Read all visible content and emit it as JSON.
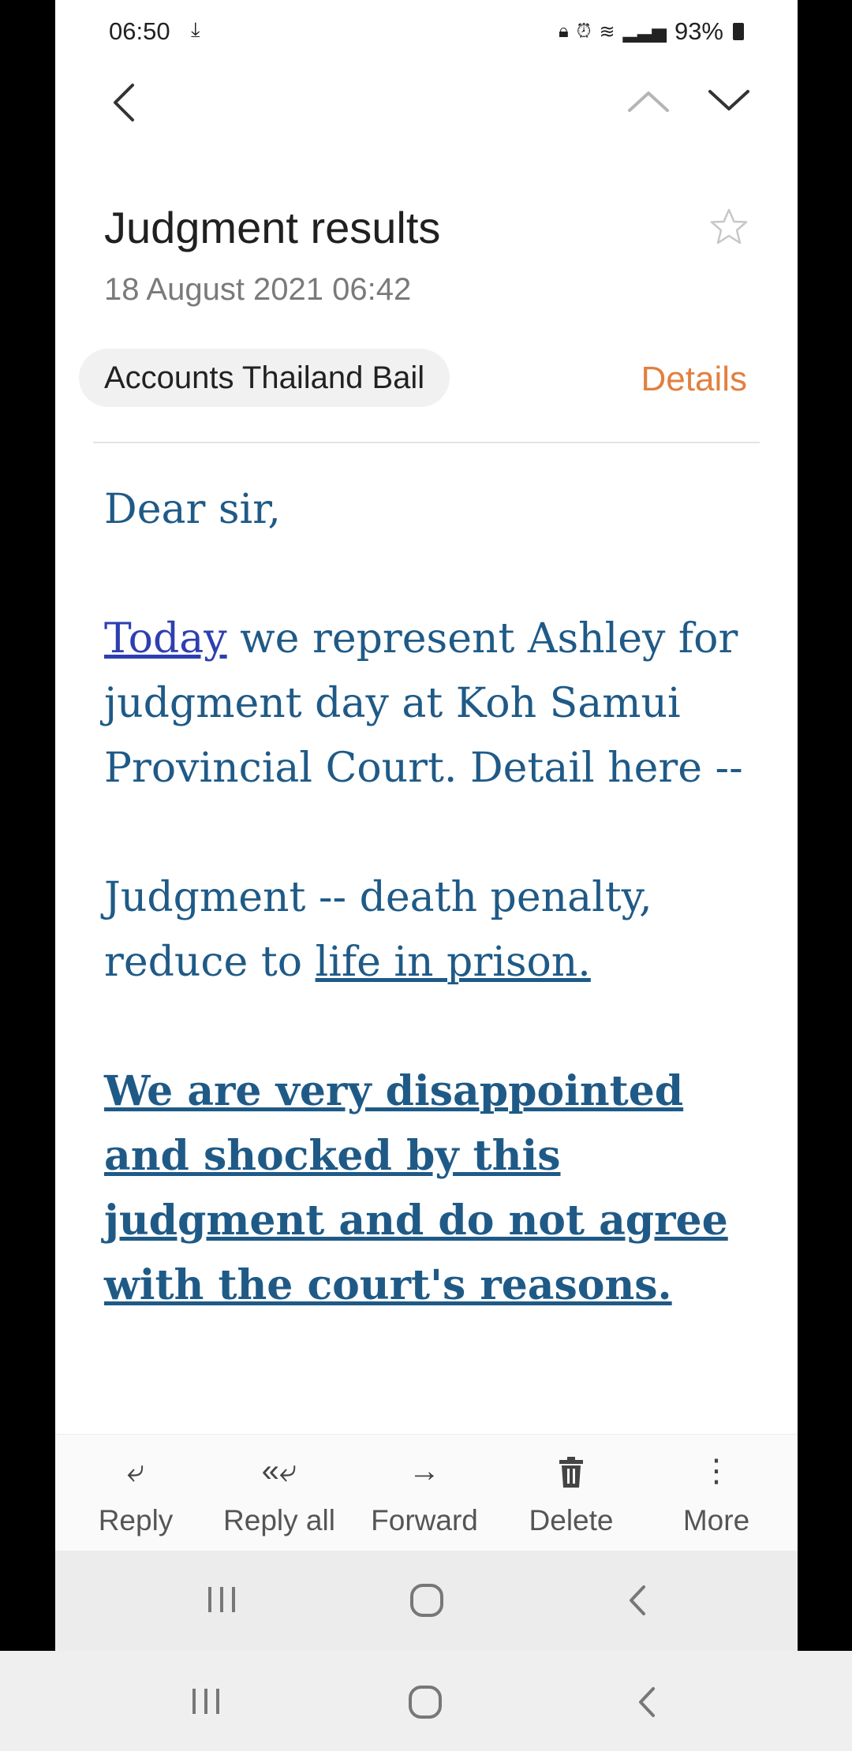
{
  "status_bar": {
    "time": "06:50",
    "battery": "93%",
    "icons": [
      "download-icon",
      "lock-icon",
      "alarm-icon",
      "wifi-icon",
      "call-icon",
      "signal-icon",
      "battery-icon"
    ]
  },
  "toolbar": {
    "icons": [
      "back-icon",
      "previous-email-icon",
      "next-email-icon"
    ]
  },
  "email": {
    "subject": "Judgment results",
    "date": "18 August 2021  06:42",
    "sender": "Accounts Thailand Bail",
    "details_label": "Details",
    "body": {
      "greeting": "Dear sir,",
      "p1_link": "Today",
      "p1_rest": " we represent Ashley for judgment day at Koh Samui Provincial Court. Detail here --",
      "p2_prefix": "Judgment -- death penalty, reduce to ",
      "p2_link": "life in prison. ",
      "p3": "We are very disappointed and shocked by this judgment and do not agree with the court's reasons. "
    }
  },
  "actions": [
    {
      "label": "Reply",
      "icon": "reply-icon"
    },
    {
      "label": "Reply all",
      "icon": "reply-all-icon"
    },
    {
      "label": "Forward",
      "icon": "forward-icon"
    },
    {
      "label": "Delete",
      "icon": "trash-icon"
    },
    {
      "label": "More",
      "icon": "more-icon"
    }
  ],
  "colors": {
    "accent": "#e1803f",
    "body_text": "#1f5a87",
    "link": "#2d3fb0"
  }
}
